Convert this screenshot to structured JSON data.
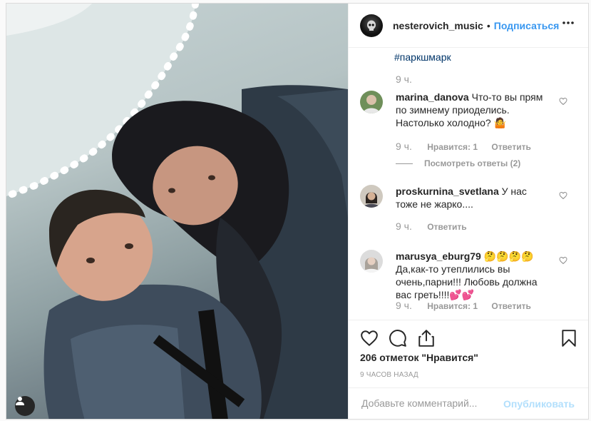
{
  "header": {
    "username": "nesterovich_music",
    "separator": "•",
    "follow_label": "Подписаться",
    "avatar_icon": "skull-avatar-icon",
    "more_icon": "more-options-icon"
  },
  "caption": {
    "hashtag": "#паркшмарк",
    "time": "9 ч."
  },
  "comments": [
    {
      "username": "marina_danova",
      "text": "Что-то вы прям по зимнему приоделись. Настолько холодно? 🤷",
      "time": "9 ч.",
      "likes": "Нравится: 1",
      "reply_label": "Ответить",
      "view_replies": "Посмотреть ответы (2)"
    },
    {
      "username": "proskurnina_svetlana",
      "text": "У нас тоже не жарко....",
      "time": "9 ч.",
      "reply_label": "Ответить"
    },
    {
      "username": "marusya_eburg79",
      "text": "🤔🤔🤔🤔Да,как-то утеплились вы очень,парни!!! Любовь должна вас греть!!!!💕💕",
      "time": "9 ч.",
      "likes": "Нравится: 1",
      "reply_label": "Ответить"
    }
  ],
  "actions": {
    "like_icon": "heart-icon",
    "comment_icon": "comment-bubble-icon",
    "share_icon": "share-icon",
    "save_icon": "bookmark-icon",
    "likes_text": "206 отметок \"Нравится\"",
    "posted_time": "9 ЧАСОВ НАЗАД"
  },
  "add_comment": {
    "placeholder": "Добавьте комментарий...",
    "publish_label": "Опубликовать"
  },
  "colors": {
    "link": "#003569",
    "follow": "#3897f0",
    "muted": "#999999",
    "publish_disabled": "#b2dffc"
  }
}
